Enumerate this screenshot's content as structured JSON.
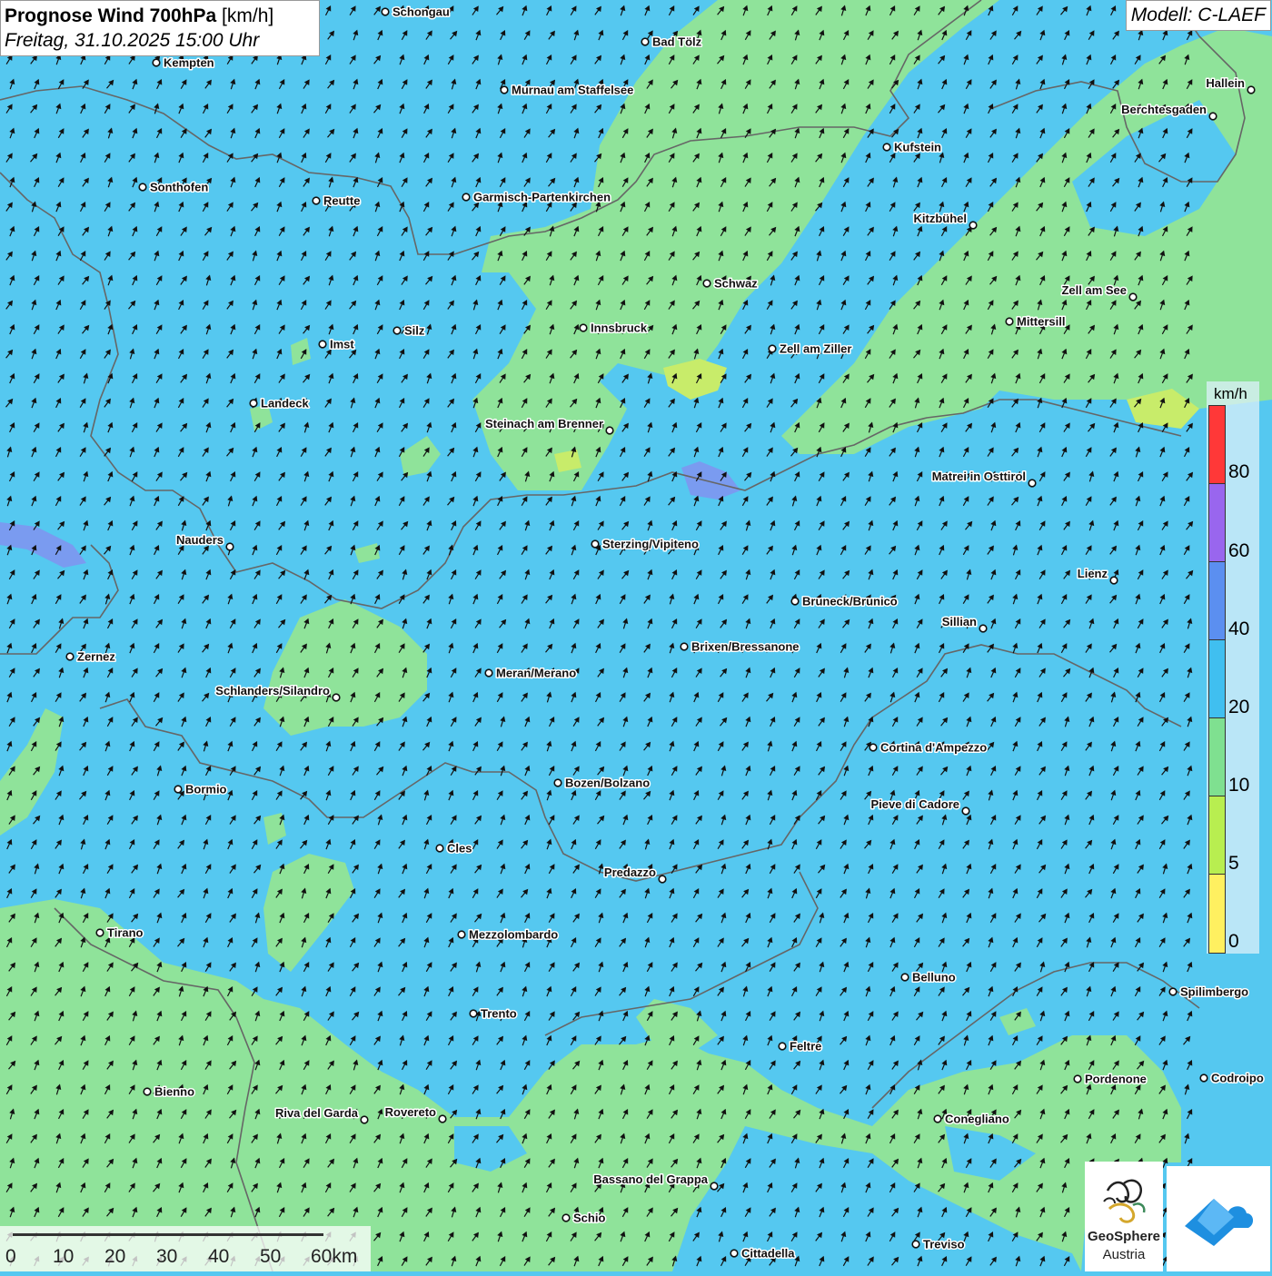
{
  "header": {
    "title_bold": "Prognose Wind 700hPa",
    "title_unit": "[km/h]",
    "datetime": "Freitag, 31.10.2025 15:00 Uhr"
  },
  "model": "Modell: C-LAEF",
  "legend": {
    "unit": "km/h",
    "ticks": [
      "80",
      "60",
      "40",
      "20",
      "10",
      "5",
      "0"
    ],
    "colors": {
      "80_plus": "#ff3838",
      "60_80": "#9966ee",
      "40_60": "#5b8ff0",
      "20_40": "#40bff0",
      "10_20": "#7fe090",
      "5_10": "#b8ee50",
      "0_5": "#fff060"
    }
  },
  "scale": {
    "labels": [
      "0",
      "10",
      "20",
      "30",
      "40",
      "50",
      "60km"
    ]
  },
  "logos": {
    "geosphere_line1": "GeoSphere",
    "geosphere_line2": "Austria",
    "cloud_icon": "geosphere-cloud-icon"
  },
  "cities": [
    "Schongau",
    "Bad Tölz",
    "Kempten",
    "Murnau am Staffelsee",
    "Hallein",
    "Berchtesgaden",
    "Kufstein",
    "Sonthofen",
    "Reutte",
    "Garmisch-Partenkirchen",
    "Kitzbühel",
    "Schwaz",
    "Zell am See",
    "Mittersill",
    "Innsbruck",
    "Silz",
    "Imst",
    "Zell am Ziller",
    "Landeck",
    "Steinach am Brenner",
    "Matrei in Osttirol",
    "Nauders",
    "Sterzing/Vipiteno",
    "Lienz",
    "Bruneck/Brunico",
    "Sillian",
    "Zernez",
    "Brixen/Bressanone",
    "Meran/Merano",
    "Schlanders/Silandro",
    "Cortina d'Ampezzo",
    "Bormio",
    "Bozen/Bolzano",
    "Pieve di Cadore",
    "Cles",
    "Predazzo",
    "Tirano",
    "Mezzolombardo",
    "Belluno",
    "Spilimbergo",
    "Trento",
    "Feltre",
    "Pordenone",
    "Codroipo",
    "Bienno",
    "Riva del Garda",
    "Rovereto",
    "Conegliano",
    "Bassano del Grappa",
    "Schio",
    "Treviso",
    "Cittadella"
  ],
  "map_colors": {
    "wind_20_40": "#55c8f0",
    "wind_10_20": "#8fe39a",
    "wind_5_10": "#c8ec6a",
    "wind_40_60": "#7a9bf0",
    "arrow": "#111111",
    "border": "#666666"
  }
}
